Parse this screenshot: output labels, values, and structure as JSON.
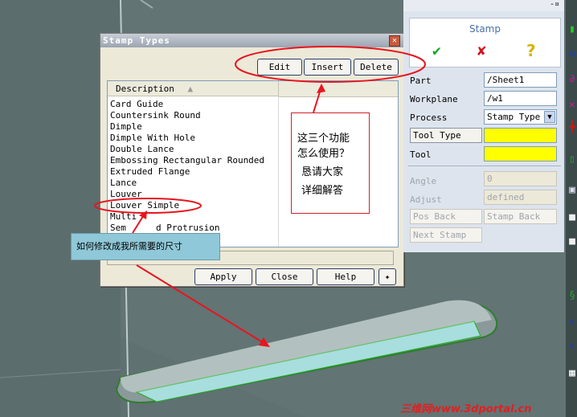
{
  "dialog": {
    "title": "Stamp Types",
    "close_glyph": "✕",
    "buttons": {
      "edit": "Edit",
      "insert": "Insert",
      "delete": "Delete",
      "apply": "Apply",
      "close": "Close",
      "help": "Help"
    },
    "column_header": "Description",
    "items": [
      "Card Guide",
      "Countersink Round",
      "Dimple",
      "Dimple With Hole",
      "Double Lance",
      "Embossing Rectangular Rounded",
      "Extruded Flange",
      "Lance",
      "Louver",
      "Louver Simple",
      "Multi",
      "Sem",
      "d Protrusion"
    ],
    "selected_item": "Louver Simple"
  },
  "stamp_panel": {
    "title": "Stamp",
    "ok_glyph": "✔",
    "cancel_glyph": "✘",
    "help_glyph": "?",
    "pin_glyph": "-¤",
    "fields": {
      "part_label": "Part",
      "part_value": "/Sheet1",
      "workplane_label": "Workplane",
      "workplane_value": "/w1",
      "process_label": "Process",
      "process_value": "Stamp Type",
      "tooltype_label": "Tool Type",
      "tool_label": "Tool",
      "angle_label": "Angle",
      "angle_value": "0",
      "adjust_label": "Adjust",
      "adjust_value": "defined",
      "posback_label": "Pos Back",
      "stampback_label": "Stamp Back",
      "nextstamp_label": "Next Stamp"
    }
  },
  "annotations": {
    "question": [
      "这三个功能",
      "怎么使用？",
      "恳请大家",
      "详细解答"
    ],
    "note": "如何修改成我所需要的尺寸"
  },
  "watermark": "三维网www.3dportal.cn",
  "colors": {
    "highlight_yellow": "#ffff00",
    "annotation_red": "#e8141e",
    "note_blue": "#8fc8d8"
  }
}
